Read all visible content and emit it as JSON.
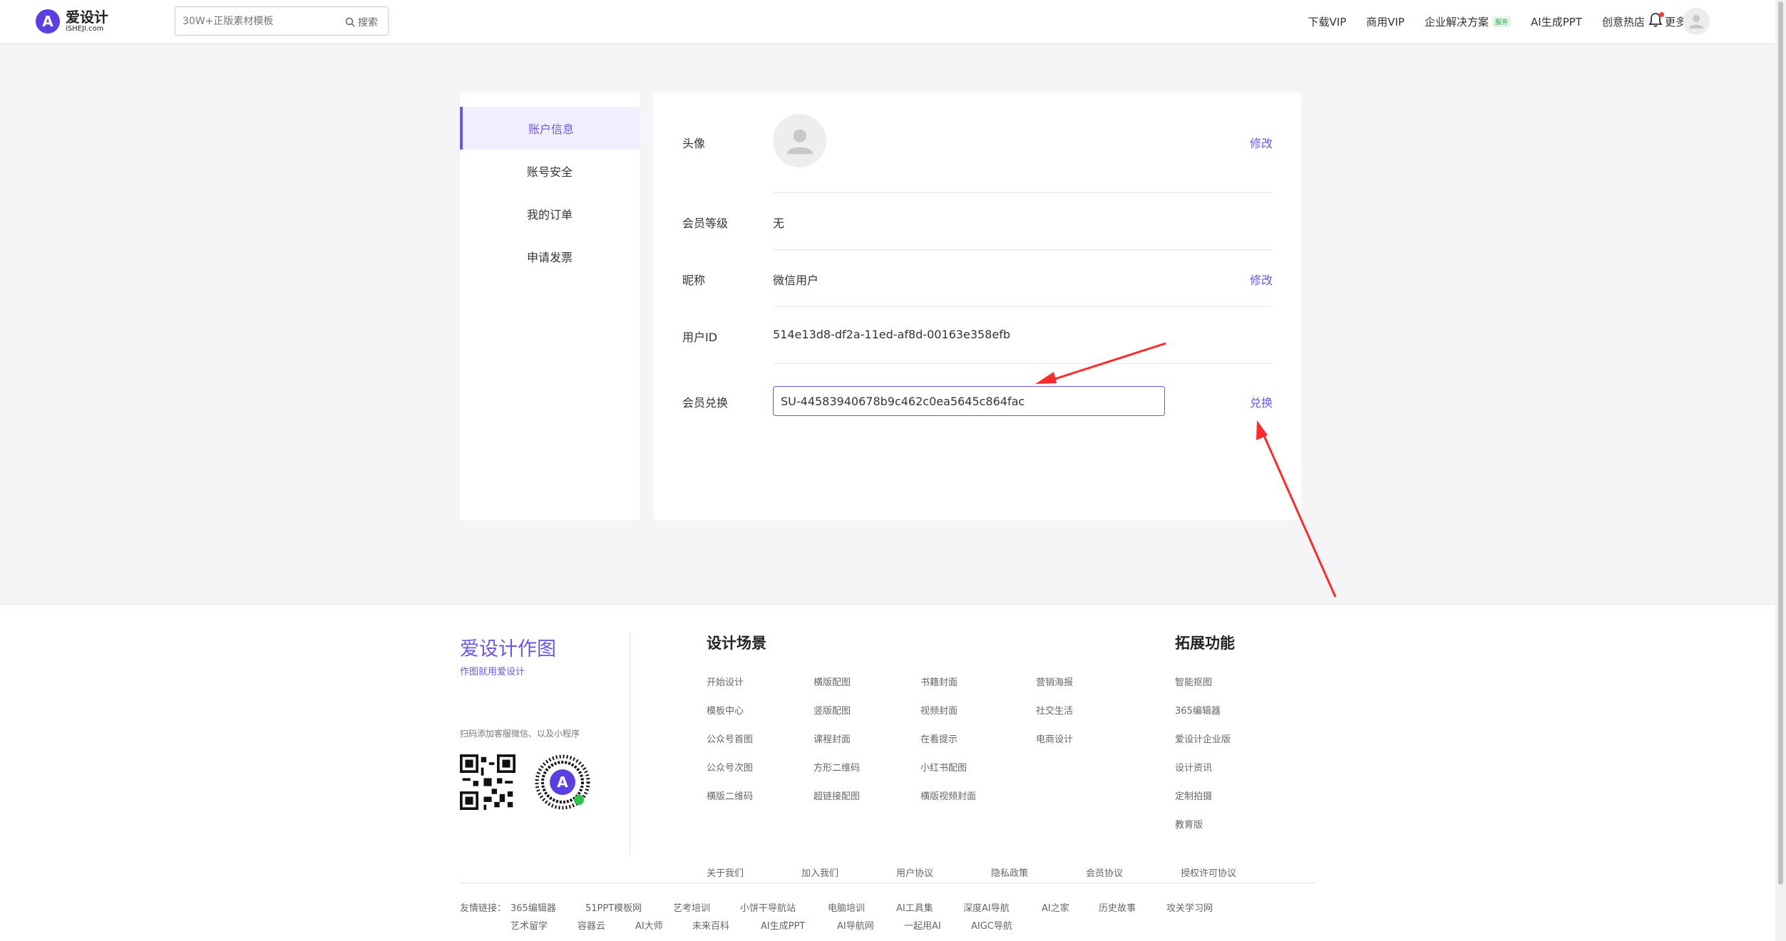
{
  "header": {
    "logo_cn": "爱设计",
    "logo_en": "iSHEJI.com",
    "search_placeholder": "30W+正版素材模板",
    "search_btn": "搜索",
    "nav": [
      {
        "label": "下载VIP"
      },
      {
        "label": "商用VIP"
      },
      {
        "label": "企业解决方案",
        "badge": "服务"
      },
      {
        "label": "AI生成PPT"
      },
      {
        "label": "创意热店"
      },
      {
        "label": "更多"
      }
    ]
  },
  "sidebar": {
    "items": [
      "账户信息",
      "账号安全",
      "我的订单",
      "申请发票"
    ]
  },
  "profile": {
    "avatar_label": "头像",
    "avatar_action": "修改",
    "level_label": "会员等级",
    "level_value": "无",
    "nickname_label": "昵称",
    "nickname_value": "微信用户",
    "nickname_action": "修改",
    "userid_label": "用户ID",
    "userid_value": "514e13d8-df2a-11ed-af8d-00163e358efb",
    "redeem_label": "会员兑换",
    "redeem_value": "SU-44583940678b9c462c0ea5645c864fac",
    "redeem_action": "兑换"
  },
  "colors": {
    "accent": "#6b57e6",
    "arrow": "#ff2a2a"
  },
  "footer": {
    "brand": "爱设计作图",
    "slogan": "作图就用爱设计",
    "qr_text": "扫码添加客服微信、以及小程序",
    "scenes_title": "设计场景",
    "scenes": [
      [
        "开始设计",
        "模板中心",
        "公众号首图",
        "公众号次图",
        "横版二维码"
      ],
      [
        "横版配图",
        "竖版配图",
        "课程封面",
        "方形二维码",
        "超链接配图"
      ],
      [
        "书籍封面",
        "视频封面",
        "在看提示",
        "小红书配图",
        "横版视频封面"
      ],
      [
        "营销海报",
        "社交生活",
        "电商设计"
      ]
    ],
    "ext_title": "拓展功能",
    "ext": [
      "智能抠图",
      "365编辑器",
      "爱设计企业版",
      "设计资讯",
      "定制拍摄",
      "教育版"
    ],
    "bottom_links": [
      "关于我们",
      "加入我们",
      "用户协议",
      "隐私政策",
      "会员协议",
      "授权许可协议"
    ],
    "friend_label": "友情链接：",
    "friends_row1": [
      "365编辑器",
      "51PPT模板网",
      "艺考培训",
      "小饼干导航站",
      "电脑培训",
      "AI工具集",
      "深度AI导航",
      "AI之家",
      "历史故事",
      "攻关学习网"
    ],
    "friends_row2": [
      "艺术留学",
      "容器云",
      "AI大师",
      "未来百科",
      "AI生成PPT",
      "AI导航网",
      "一起用AI",
      "AIGC导航"
    ]
  }
}
